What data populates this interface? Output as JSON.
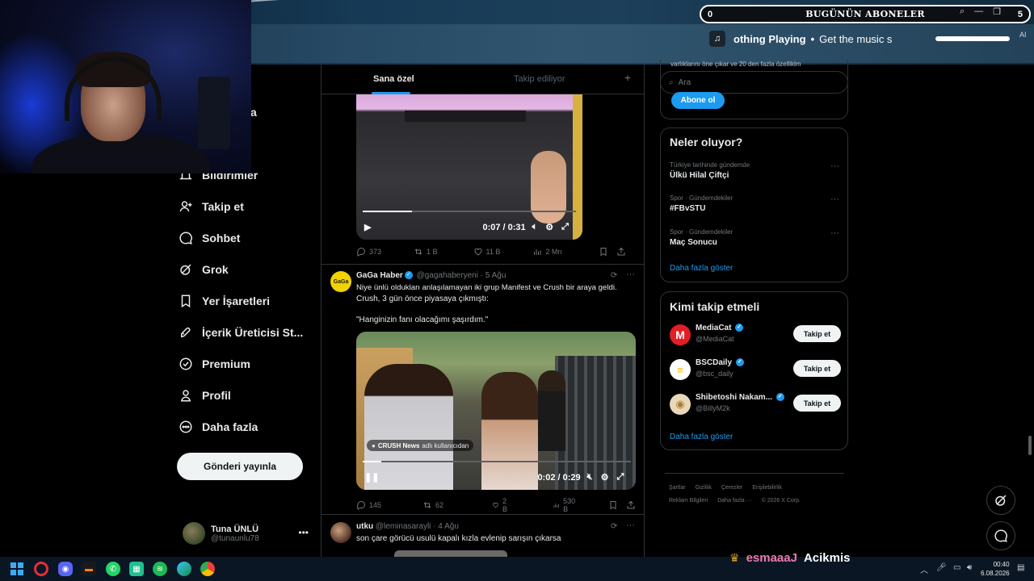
{
  "overlay": {
    "subs_count": "0",
    "subs_title": "BUGÜNÜN ABONELER",
    "subs_right": "5",
    "music_note": "♫",
    "music_title": "othing Playing",
    "music_separator": "•",
    "music_sub": "Get the music s",
    "ai_tag": "AI",
    "chat_user": "esmaaaJ",
    "chat_message": "Acikmis",
    "crown": "♛"
  },
  "nav": {
    "partial_label": "a",
    "items": [
      {
        "label": "Bildirimler",
        "icon": "bell-icon"
      },
      {
        "label": "Takip et",
        "icon": "follow-user-icon"
      },
      {
        "label": "Sohbet",
        "icon": "chat-icon"
      },
      {
        "label": "Grok",
        "icon": "grok-icon"
      },
      {
        "label": "Yer İşaretleri",
        "icon": "bookmark-icon"
      },
      {
        "label": "İçerik Üreticisi St...",
        "icon": "rocket-icon"
      },
      {
        "label": "Premium",
        "icon": "premium-icon"
      },
      {
        "label": "Profil",
        "icon": "profile-icon"
      },
      {
        "label": "Daha fazla",
        "icon": "more-circle-icon"
      }
    ],
    "post_button": "Gönderi yayınla",
    "account": {
      "name": "Tuna ÜNLÜ",
      "handle": "@tunaunlu78",
      "more": "•••"
    }
  },
  "feed": {
    "tab_for_you": "Sana özel",
    "tab_following": "Takip ediliyor",
    "tab_add": "+",
    "post1": {
      "video_time": "0:07 / 0:31",
      "video_progress": 0.23,
      "replies": "373",
      "reposts": "1 B",
      "likes": "11 B",
      "views": "2 Mn"
    },
    "post2": {
      "name": "GaGa Haber",
      "handle": "@gagahaberyeni",
      "date": "· 5 Ağu",
      "avatar_text": "GaGa",
      "text_line1": "Niye ünlü oldukları anlaşılamayan iki grup Manifest ve Crush bir araya geldi.",
      "text_line2": "Crush, 3 gün önce piyasaya çıkmıştı:",
      "quote": "\"Hanginizin fanı olacağımı şaşırdım.\"",
      "tag_source": "CRUSH News",
      "tag_suffix": "adlı kullanıcıdan",
      "video_time": "0:02 / 0:29",
      "video_progress": 0.07,
      "replies": "145",
      "reposts": "62",
      "likes": "2 B",
      "views": "530 B"
    },
    "post3": {
      "name": "utku",
      "handle": "@leminasarayli",
      "date": "· 4 Ağu",
      "text": "son çare görücü usulü kapalı kızla evlenip sarışın çıkarsa"
    }
  },
  "sidebar": {
    "premium_cut_text": "varlıklarını öne çıkar ve 20 den fazla özelliklm",
    "subscribe_button": "Abone ol",
    "search_placeholder": "Ara",
    "trends_title": "Neler oluyor?",
    "trends": [
      {
        "context": "Türkiye tarihinde gündemde",
        "title": "Ülkü Hilal Çiftçi"
      },
      {
        "context": "Spor · Gündemdekiler",
        "title": "#FBvSTU"
      },
      {
        "context": "Spor · Gündemdekiler",
        "title": "Maç Sonucu"
      }
    ],
    "show_more": "Daha fazla göster",
    "who_to_follow_title": "Kimi takip etmeli",
    "follows": [
      {
        "name": "MediaCat",
        "handle": "@MediaCat",
        "button": "Takip et",
        "avatar_text": "M",
        "color": "#e31e24"
      },
      {
        "name": "BSCDaily",
        "handle": "@bsc_daily",
        "button": "Takip et",
        "avatar_text": "≡",
        "color": "#f5b000"
      },
      {
        "name": "Shibetoshi Nakam...",
        "handle": "@BillyM2k",
        "button": "Takip et",
        "avatar_text": "◉",
        "color": "#d8b070"
      }
    ],
    "show_more2": "Daha fazla göster",
    "footer_line1": [
      "Şartlar",
      "Gizlilik",
      "Çerezler",
      "Erişilebilirlik"
    ],
    "footer_line2": [
      "Reklam Bilgileri",
      "Daha fazla ···",
      "© 2026 X Corp."
    ]
  },
  "taskbar": {
    "time": "00:40",
    "date": "6.08.2026"
  },
  "colors": {
    "accent": "#1d9bf0",
    "background": "#000000",
    "text": "#e7e9ea",
    "muted": "#71767b"
  }
}
